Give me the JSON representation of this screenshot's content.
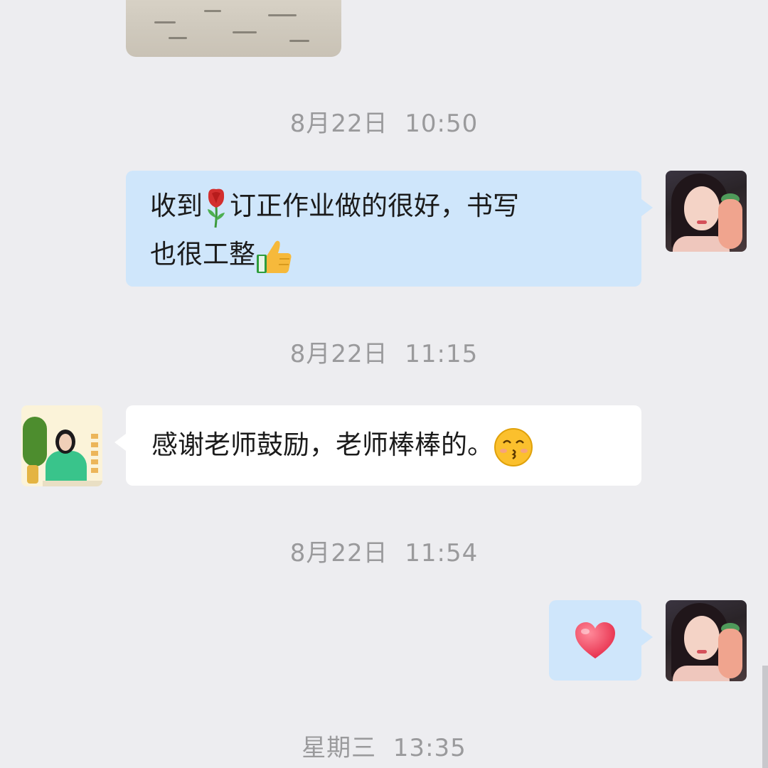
{
  "messages": {
    "image": {
      "type": "image"
    },
    "ts1": "8月22日  10:50",
    "msg1": {
      "text_a": "收到",
      "text_b": "订正作业做的很好，书写",
      "text_c": "也很工整",
      "emoji_rose": "rose-icon",
      "emoji_thumb": "thumbs-up-icon"
    },
    "ts2": "8月22日  11:15",
    "msg2": {
      "text": "感谢老师鼓励，老师棒棒的。",
      "emoji": "kissing-smiling-eyes-icon"
    },
    "ts3": "8月22日  11:54",
    "msg3": {
      "emoji": "heart-icon"
    },
    "ts4": "星期三  13:35"
  },
  "colors": {
    "background": "#ededf0",
    "outgoing_bubble": "#cfe6fb",
    "incoming_bubble": "#ffffff",
    "timestamp": "#9a9a9c"
  }
}
